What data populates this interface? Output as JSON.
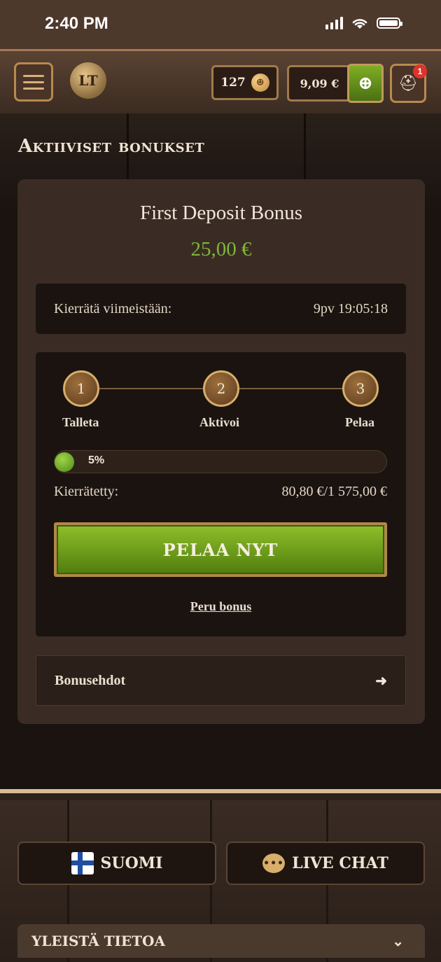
{
  "status_bar": {
    "time": "2:40 PM"
  },
  "header": {
    "logo": "LT",
    "coins": "127",
    "balance": "9,09 €",
    "notification_count": "1"
  },
  "page": {
    "title": "Aktiiviset bonukset"
  },
  "bonus": {
    "title": "First Deposit Bonus",
    "amount": "25,00 €",
    "expire_label": "Kierrätä viimeistään:",
    "expire_value": "9pv 19:05:18",
    "steps": [
      {
        "number": "1",
        "label": "Talleta"
      },
      {
        "number": "2",
        "label": "Aktivoi"
      },
      {
        "number": "3",
        "label": "Pelaa"
      }
    ],
    "progress_percent": 5,
    "progress_text": "5%",
    "wagered_label": "Kierrätetty:",
    "wagered_value": "80,80 €/1 575,00 €",
    "play_button": "PELAA NYT",
    "cancel_link": "Peru bonus",
    "terms_label": "Bonusehdot"
  },
  "footer": {
    "language_button": "SUOMI",
    "chat_button": "LIVE CHAT",
    "info_section": "YLEISTÄ TIETOA"
  },
  "colors": {
    "accent_green": "#7fb63a",
    "gold": "#d7ae6a",
    "background": "#1a1310"
  }
}
